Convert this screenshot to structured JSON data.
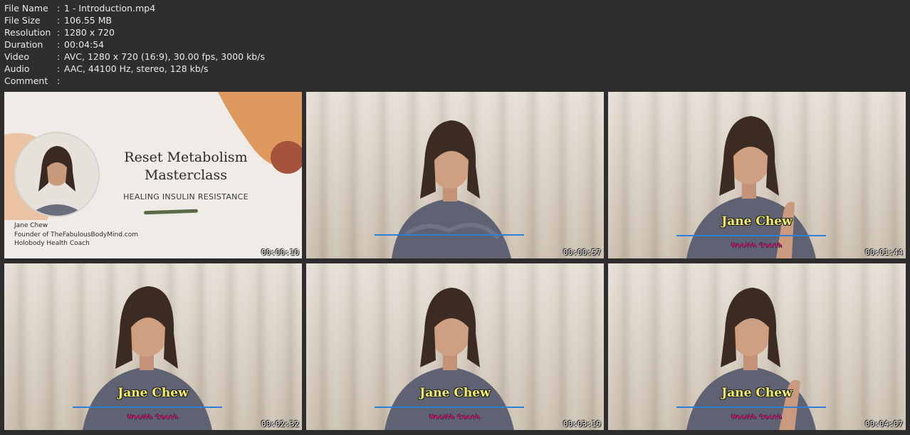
{
  "file_info": [
    {
      "label": "File Name",
      "value": "1 - Introduction.mp4"
    },
    {
      "label": "File Size",
      "value": "106.55 MB"
    },
    {
      "label": "Resolution",
      "value": "1280 x 720"
    },
    {
      "label": "Duration",
      "value": "00:04:54"
    },
    {
      "label": "Video",
      "value": "AVC, 1280 x 720 (16:9), 30.00 fps, 3000 kb/s"
    },
    {
      "label": "Audio",
      "value": "AAC, 44100 Hz, stereo, 128 kb/s"
    },
    {
      "label": "Comment",
      "value": ""
    }
  ],
  "separator": ":",
  "title_slide": {
    "title_line1": "Reset Metabolism",
    "title_line2": "Masterclass",
    "subtitle": "HEALING INSULIN RESISTANCE",
    "presenter": "Jane Chew",
    "role1": "Founder of TheFabulousBodyMind.com",
    "role2": "Holobody Health Coach"
  },
  "lower_third": {
    "name": "Jane Chew",
    "role": "Health Coach"
  },
  "timecodes": [
    "00:00:10",
    "00:00:57",
    "00:01:44",
    "00:02:32",
    "00:03:19",
    "00:04:07"
  ]
}
